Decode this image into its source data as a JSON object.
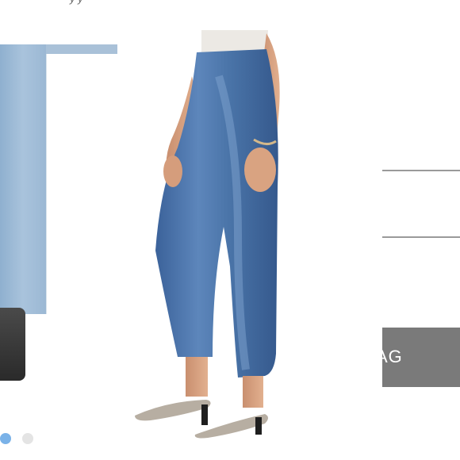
{
  "top_caption": "y y",
  "cart": {
    "button_label": "AG"
  },
  "carousel": {
    "slide_count": 2,
    "active_index": 0
  },
  "colors": {
    "active_dot": "#7ab2e8",
    "inactive_dot": "#e4e4e4",
    "button_bg": "#7a7a7a",
    "divider": "#9a9a9a",
    "denim": "#4a74a8"
  },
  "icons": [
    "carousel-dot",
    "carousel-dot"
  ]
}
